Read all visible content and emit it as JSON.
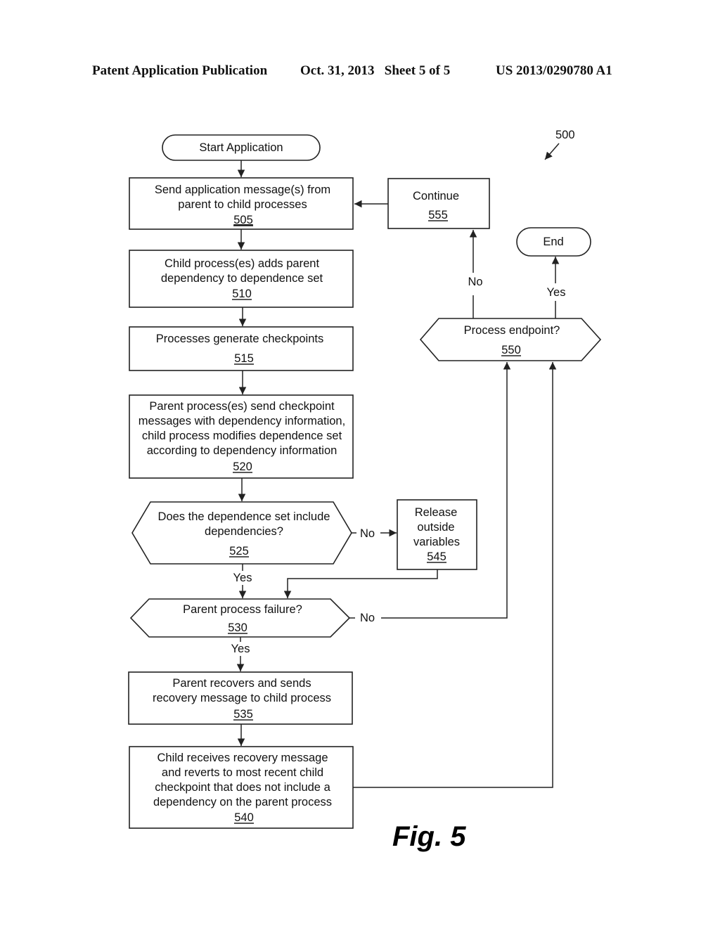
{
  "header": {
    "left": "Patent Application Publication",
    "date_sheet": "Oct. 31, 2013   Sheet 5 of 5",
    "number": "US 2013/0290780 A1"
  },
  "diagram": {
    "ref": "500",
    "figure_label": "Fig. 5",
    "nodes": {
      "start": {
        "text": "Start Application"
      },
      "n505": {
        "lines": [
          "Send application message(s) from",
          "parent to child processes"
        ],
        "ref": "505"
      },
      "n510": {
        "lines": [
          "Child process(es) adds parent",
          "dependency to dependence set"
        ],
        "ref": "510"
      },
      "n515": {
        "lines": [
          "Processes generate checkpoints"
        ],
        "ref": "515"
      },
      "n520": {
        "lines": [
          "Parent process(es) send checkpoint",
          "messages with dependency information,",
          "child process modifies dependence set",
          "according to dependency information"
        ],
        "ref": "520"
      },
      "n525": {
        "lines": [
          "Does the dependence set include",
          "dependencies?"
        ],
        "ref": "525"
      },
      "n530": {
        "lines": [
          "Parent process failure?"
        ],
        "ref": "530"
      },
      "n535": {
        "lines": [
          "Parent recovers and sends",
          "recovery message to child process"
        ],
        "ref": "535"
      },
      "n540": {
        "lines": [
          "Child receives recovery message",
          "and reverts to most recent child",
          "checkpoint that does not include a",
          "dependency on the parent process"
        ],
        "ref": "540"
      },
      "n545": {
        "lines": [
          "Release",
          "outside",
          "variables"
        ],
        "ref": "545"
      },
      "n550": {
        "lines": [
          "Process endpoint?"
        ],
        "ref": "550"
      },
      "n555": {
        "lines": [
          "Continue"
        ],
        "ref": "555"
      },
      "end": {
        "text": "End"
      }
    },
    "edge_labels": {
      "n525_no": "No",
      "n525_yes": "Yes",
      "n530_no": "No",
      "n530_yes": "Yes",
      "n550_no": "No",
      "n550_yes": "Yes"
    }
  }
}
